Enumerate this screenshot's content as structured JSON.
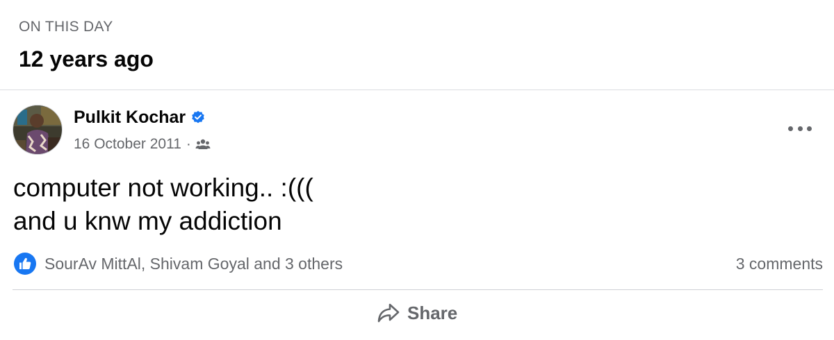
{
  "memory": {
    "label": "ON THIS DAY",
    "title": "12 years ago"
  },
  "post": {
    "author": "Pulkit Kochar",
    "verified": true,
    "date": "16 October 2011",
    "separator": "·",
    "audience_icon": "friends-icon",
    "body_lines": [
      "computer not working.. :(((",
      "and u knw my addiction"
    ]
  },
  "reactions": {
    "icon": "like-icon",
    "text": "SourAv MittAl, Shivam Goyal and 3 others",
    "comments": "3 comments"
  },
  "actions": {
    "share_label": "Share",
    "share_icon": "share-icon"
  },
  "colors": {
    "text_primary": "#050505",
    "text_secondary": "#65676b",
    "accent_blue": "#1877f2",
    "divider": "#dadde1"
  }
}
